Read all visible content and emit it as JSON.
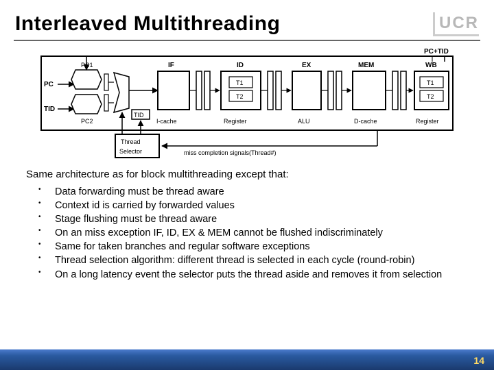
{
  "title": "Interleaved Multithreading",
  "logo": "UCR",
  "page_number": "14",
  "intro": "Same architecture as for block multithreading except that:",
  "bullets": [
    "Data forwarding must be thread aware",
    "Context id is carried by forwarded values",
    "Stage flushing must be thread aware",
    "On an miss exception IF, ID, EX & MEM cannot be flushed indiscriminately",
    "Same for taken branches and regular software exceptions",
    "Thread selection algorithm: different thread is selected in each cycle (round-robin)",
    "On a long latency event the selector puts the thread aside and removes it from selection"
  ],
  "diagram": {
    "top_signal": "PC+TID",
    "inputs": {
      "pc": "PC",
      "tid": "TID"
    },
    "pcs": {
      "pc1": "PC1",
      "pc2": "PC2"
    },
    "tid_box": "TID",
    "stages": {
      "if": "IF",
      "id": "ID",
      "ex": "EX",
      "mem": "MEM",
      "wb": "WB"
    },
    "units": {
      "icache": "I-cache",
      "register1": "Register",
      "alu": "ALU",
      "dcache": "D-cache",
      "register2": "Register"
    },
    "thread_labels": {
      "t1": "T1",
      "t2": "T2"
    },
    "selector": "Thread Selector",
    "miss_signal": "miss completion signals(Thread#)"
  }
}
